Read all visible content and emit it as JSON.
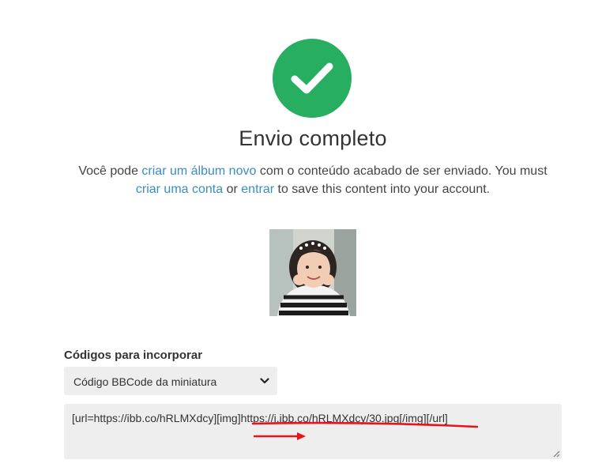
{
  "header": {
    "icon": "check-icon",
    "success_color": "#27ae60",
    "title": "Envio completo"
  },
  "message": {
    "part1": "Você pode ",
    "link_album": "criar um álbum novo",
    "part2": " com o conteúdo acabado de ser enviado. You must ",
    "link_account": "criar uma conta",
    "part3": " or ",
    "link_login": "entrar",
    "part4": " to save this content into your account.",
    "link_color": "#3b8cc4"
  },
  "embed": {
    "label": "Códigos para incorporar",
    "select_value": "Código BBCode da miniatura",
    "code": "[url=https://ibb.co/hRLMXdcy][img]https://i.ibb.co/hRLMXdcy/30.jpg[/img][/url]"
  },
  "annotation": {
    "color": "#e8141b"
  }
}
